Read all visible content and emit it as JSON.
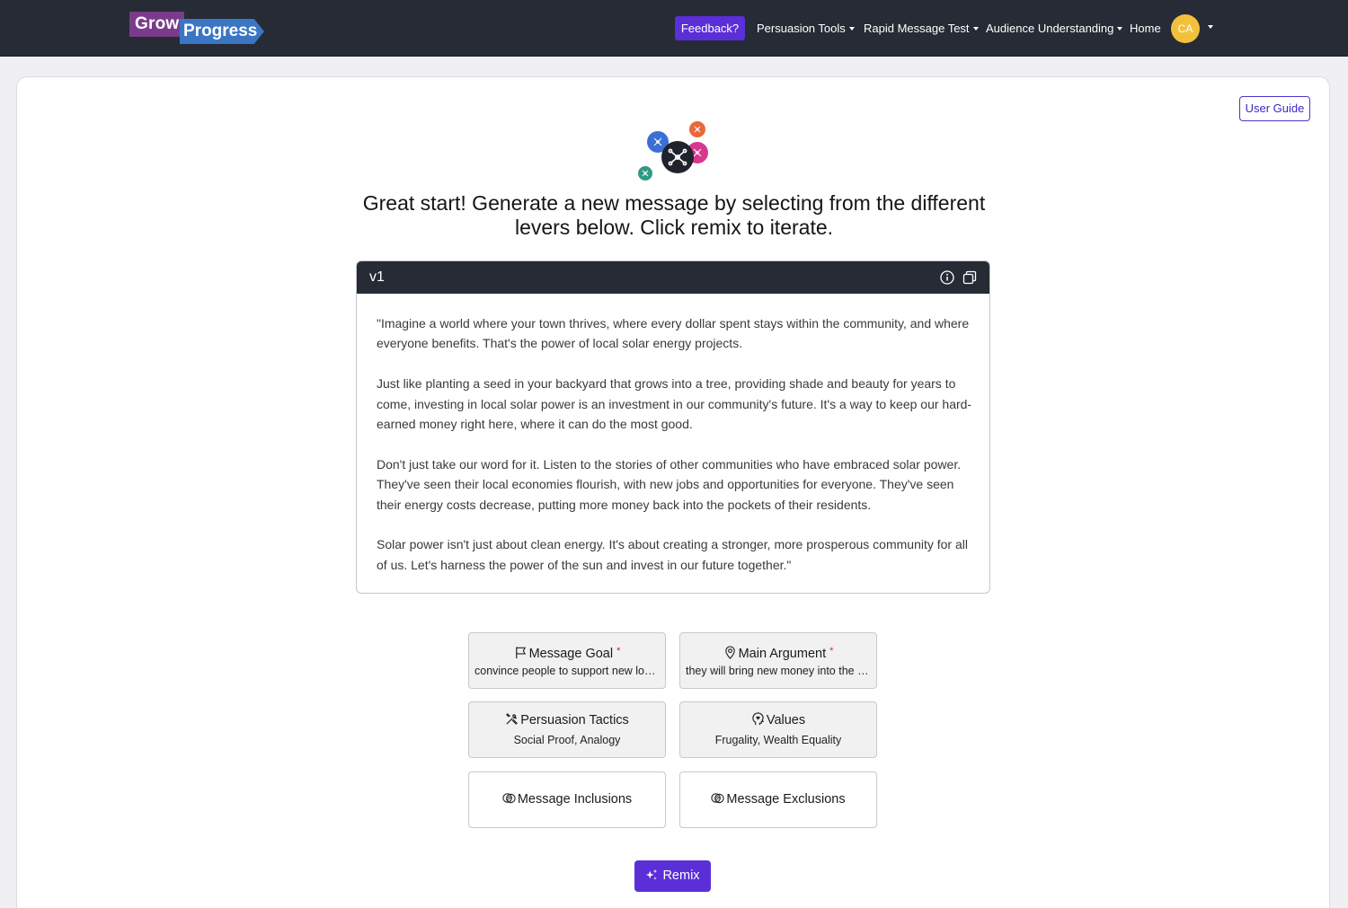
{
  "navbar": {
    "logo_grow": "Grow",
    "logo_progress": "Progress",
    "feedback_label": "Feedback?",
    "persuasion_tools": "Persuasion Tools",
    "rapid_message_test": "Rapid Message Test",
    "audience_understanding": "Audience Understanding",
    "home": "Home",
    "avatar_initials": "CA"
  },
  "user_guide_label": "User Guide",
  "headline": "Great start! Generate a new message by selecting from the different levers below. Click remix to iterate.",
  "message": {
    "version": "v1",
    "paragraphs": [
      "\"Imagine a world where your town thrives, where every dollar spent stays within the community, and where everyone benefits. That's the power of local solar energy projects.",
      "Just like planting a seed in your backyard that grows into a tree, providing shade and beauty for years to come, investing in local solar power is an investment in our community's future. It's a way to keep our hard-earned money right here, where it can do the most good.",
      "Don't just take our word for it. Listen to the stories of other communities who have embraced solar power. They've seen their local economies flourish, with new jobs and opportunities for everyone. They've seen their energy costs decrease, putting more money back into the pockets of their residents.",
      "Solar power isn't just about clean energy. It's about creating a stronger, more prosperous community for all of us. Let's harness the power of the sun and invest in our future together.\""
    ]
  },
  "levers": {
    "message_goal": {
      "title": "Message Goal",
      "required": "*",
      "value": "convince people to support new local solar energy projects"
    },
    "main_argument": {
      "title": "Main Argument",
      "required": "*",
      "value": "they will bring new money into the local economy"
    },
    "persuasion_tactics": {
      "title": "Persuasion Tactics",
      "value": "Social Proof, Analogy"
    },
    "values": {
      "title": "Values",
      "value": "Frugality, Wealth Equality"
    },
    "message_inclusions": {
      "title": "Message Inclusions"
    },
    "message_exclusions": {
      "title": "Message Exclusions"
    }
  },
  "remix_label": "Remix",
  "colors": {
    "navbar_bg": "#262b35",
    "accent_purple": "#5b2fd8",
    "avatar_yellow": "#f2c13c",
    "required_red": "#d02a2a"
  },
  "icons": {
    "hero": "network-bubbles-icon",
    "message_goal": "flag-icon",
    "main_argument": "map-pin-icon",
    "persuasion_tactics": "tools-icon",
    "values": "head-heart-icon",
    "message_inclusions": "circles-overlap-icon",
    "message_exclusions": "circles-overlap-icon",
    "remix": "sparkles-icon"
  }
}
